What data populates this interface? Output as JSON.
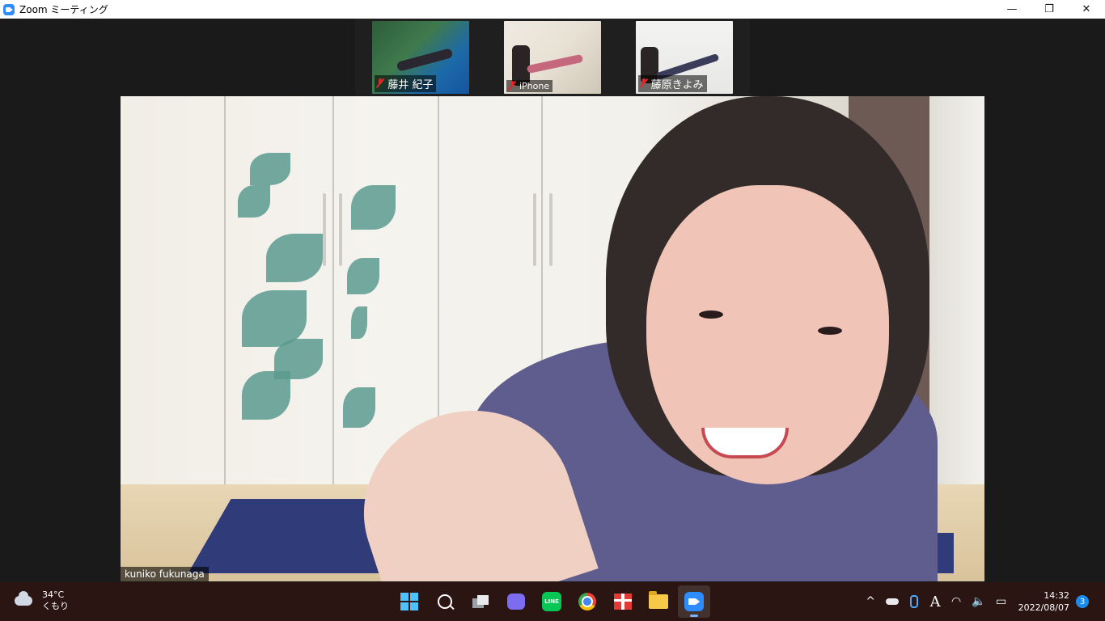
{
  "window": {
    "title": "Zoom ミーティング",
    "controls": {
      "minimize": "—",
      "restore": "❐",
      "close": "✕"
    }
  },
  "gallery": {
    "participants": [
      {
        "name": "藤井 紀子",
        "muted": true
      },
      {
        "name": "iPhone",
        "muted": true
      },
      {
        "name": "藤原きよみ",
        "muted": true
      }
    ]
  },
  "main_video": {
    "speaker_name": "kuniko fukunaga"
  },
  "taskbar": {
    "weather": {
      "temperature": "34°C",
      "condition": "くもり",
      "icon": "cloud-icon"
    },
    "apps": [
      {
        "name": "start",
        "icon": "windows-logo-icon"
      },
      {
        "name": "search",
        "icon": "search-icon"
      },
      {
        "name": "task-view",
        "icon": "task-view-icon"
      },
      {
        "name": "chat",
        "icon": "chat-icon"
      },
      {
        "name": "line",
        "icon": "line-icon",
        "text": "LINE"
      },
      {
        "name": "chrome",
        "icon": "chrome-icon"
      },
      {
        "name": "gift",
        "icon": "gift-icon"
      },
      {
        "name": "file-explorer",
        "icon": "folder-icon"
      },
      {
        "name": "zoom",
        "icon": "zoom-icon",
        "active": true
      }
    ],
    "tray": {
      "chevron": "^",
      "ime": "A",
      "time": "14:32",
      "date": "2022/08/07",
      "notifications": "3"
    }
  },
  "colors": {
    "accent": "#2d8cff",
    "muted_mic": "#e02828",
    "taskbar_bg": "#2a1512",
    "window_bg": "#1a1a1a"
  }
}
